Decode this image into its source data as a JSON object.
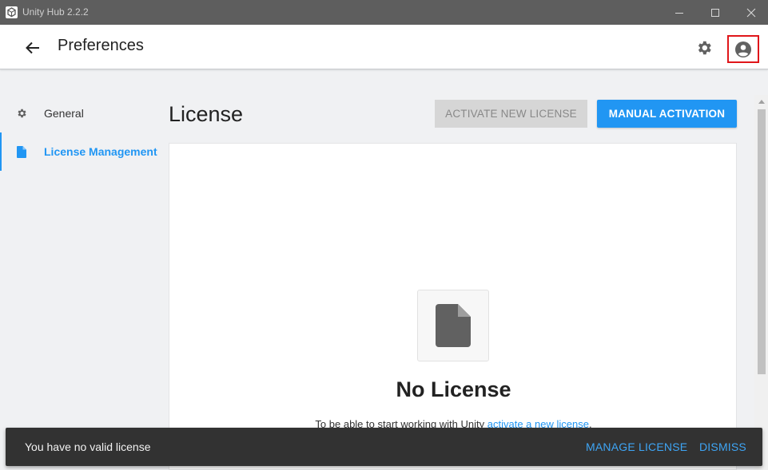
{
  "window": {
    "title": "Unity Hub 2.2.2"
  },
  "header": {
    "title": "Preferences"
  },
  "sidebar": {
    "items": [
      {
        "label": "General",
        "icon": "gear-icon",
        "active": false
      },
      {
        "label": "License Management",
        "icon": "document-icon",
        "active": true
      }
    ]
  },
  "license": {
    "title": "License",
    "activate_new_label": "ACTIVATE NEW LICENSE",
    "manual_activation_label": "MANUAL ACTIVATION",
    "empty_title": "No License",
    "hint_prefix": "To be able to start working with Unity ",
    "hint_link": "activate a new license",
    "hint_suffix": "."
  },
  "snackbar": {
    "message": "You have no valid license",
    "manage_label": "MANAGE LICENSE",
    "dismiss_label": "DISMISS"
  },
  "colors": {
    "accent": "#2196f3",
    "highlight_box": "#e0161a",
    "titlebar": "#5e5e5e",
    "snackbar": "#323232"
  }
}
